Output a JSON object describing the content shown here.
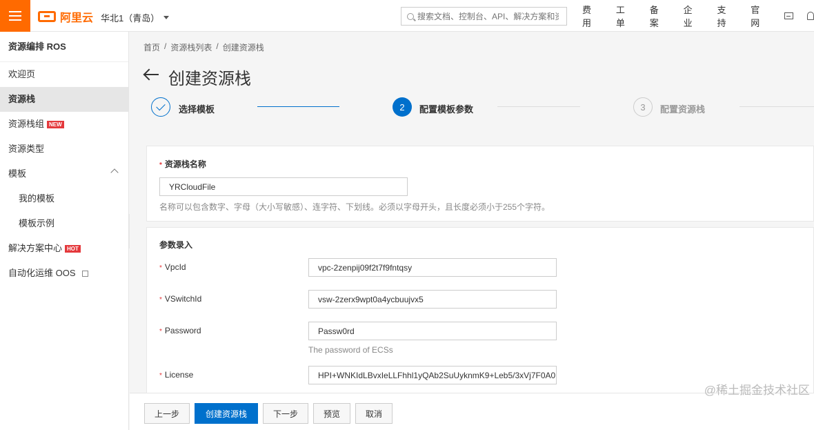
{
  "topbar": {
    "logo_text": "阿里云",
    "region": "华北1（青岛）",
    "search_placeholder": "搜索文档、控制台、API、解决方案和资",
    "nav": [
      "费用",
      "工单",
      "备案",
      "企业",
      "支持",
      "官网"
    ],
    "accent_color": "#ff6a00"
  },
  "sidebar": {
    "title": "资源编排 ROS",
    "items": {
      "welcome": "欢迎页",
      "stacks": "资源栈",
      "stack_groups": "资源栈组",
      "stack_groups_badge": "NEW",
      "resource_types": "资源类型",
      "templates": "模板",
      "my_templates": "我的模板",
      "template_examples": "模板示例",
      "solutions": "解决方案中心",
      "solutions_badge": "HOT",
      "oos": "自动化运维 OOS"
    }
  },
  "breadcrumb": [
    "首页",
    "/",
    "资源栈列表",
    "/",
    "创建资源栈"
  ],
  "page_title": "创建资源栈",
  "steps": [
    {
      "label": "选择模板",
      "state": "done"
    },
    {
      "number": "2",
      "label": "配置模板参数",
      "state": "current"
    },
    {
      "number": "3",
      "label": "配置资源栈",
      "state": "todo"
    }
  ],
  "stack_name": {
    "label": "资源栈名称",
    "value": "YRCloudFile",
    "hint": "名称可以包含数字、字母（大小写敏感）、连字符、下划线。必须以字母开头，且长度必须小于255个字符。"
  },
  "params": {
    "section_title": "参数录入",
    "vpcid_label": "VpcId",
    "vpcid_value": "vpc-2zenpij09f2t7f9fntqsy",
    "vswitch_label": "VSwitchId",
    "vswitch_value": "vsw-2zerx9wpt0a4ycbuujvx5",
    "password_label": "Password",
    "password_value": "Passw0rd",
    "password_hint": "The password of ECSs",
    "license_label": "License",
    "license_value": "HPI+WNKIdLBvxIeLLFhhl1yQAb2SuUyknmK9+Leb5/3xVj7F0A0"
  },
  "footer": {
    "prev": "上一步",
    "create": "创建资源栈",
    "next": "下一步",
    "preview": "预览",
    "cancel": "取消"
  },
  "watermark": "@稀土掘金技术社区",
  "colors": {
    "primary": "#0070cc",
    "required": "#e4393c"
  }
}
